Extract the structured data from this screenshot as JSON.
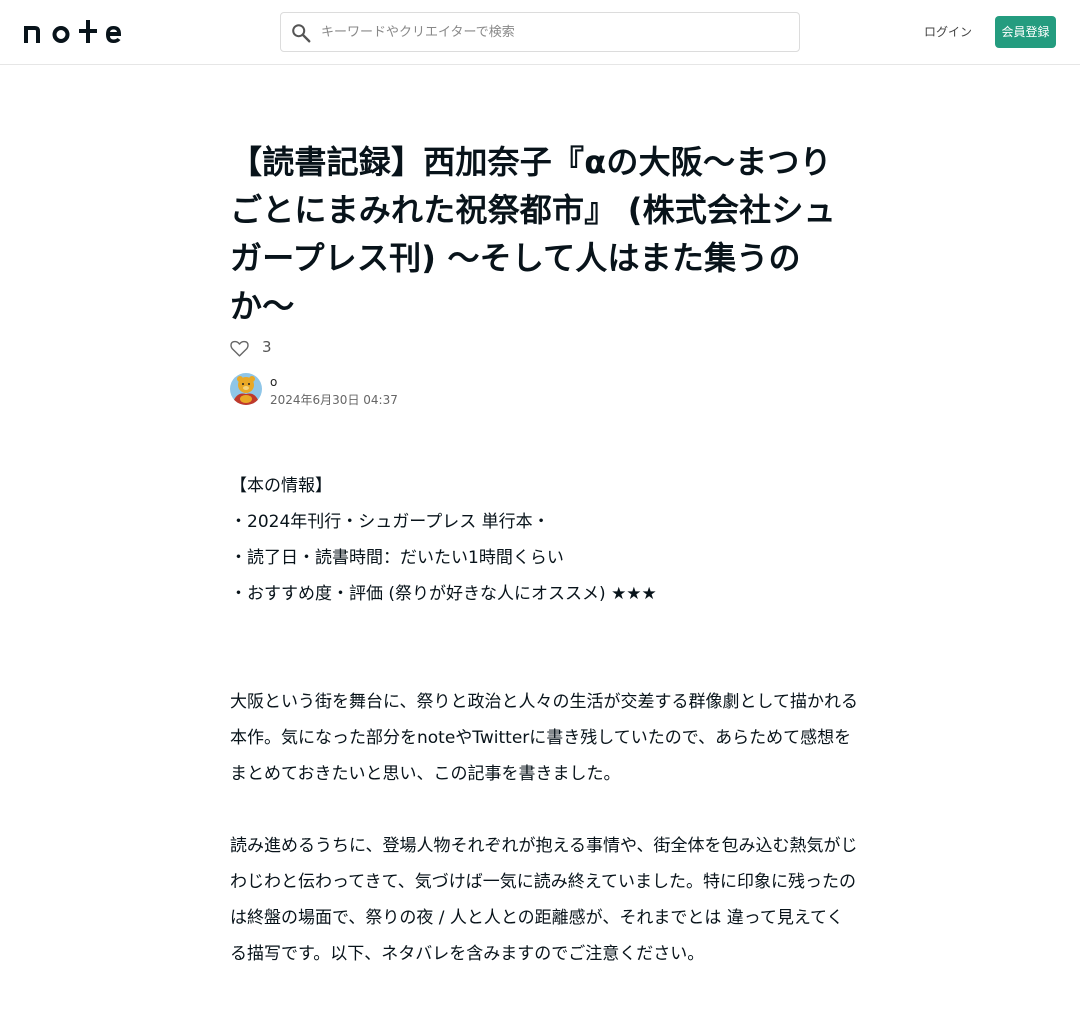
{
  "header": {
    "logo_text": "note",
    "search_placeholder": "キーワードやクリエイターで検索",
    "login_label": "ログイン",
    "signup_label": "会員登録"
  },
  "article": {
    "title": "【読書記録】西加奈子『αの大阪〜まつりごとにまみれた祝祭都市』 (株式会社シュガープレス刊) 〜そして人はまた集うのか〜",
    "like_count": "3",
    "author": {
      "name": "o",
      "published": "2024年6月30日 04:37"
    },
    "intro_lines": [
      "【本の情報】",
      "・2024年刊行・シュガープレス 単行本・",
      "・読了日・読書時間：だいたい1時間くらい",
      "・おすすめ度・評価 (祭りが好きな人にオススメ) ★★★"
    ],
    "paragraphs": [
      "大阪という街を舞台に、祭りと政治と人々の生活が交差する群像劇として描かれる本作。気になった部分をnoteやTwitterに書き残していたので、あらためて感想をまとめておきたいと思い、この記事を書きました。",
      "読み進めるうちに、登場人物それぞれが抱える事情や、街全体を包み込む熱気がじわじわと伝わってきて、気づけば一気に読み終えていました。特に印象に残ったのは終盤の場面で、祭りの夜 / 人と人との距離感が、それまでとは 違って見えてくる描写です。以下、ネタバレを含みますのでご注意ください。"
    ]
  },
  "colors": {
    "accent": "#249c7f",
    "text": "#08131a",
    "border": "#e6e6e6"
  },
  "icons": {
    "search": "search-icon",
    "heart": "heart-icon"
  }
}
